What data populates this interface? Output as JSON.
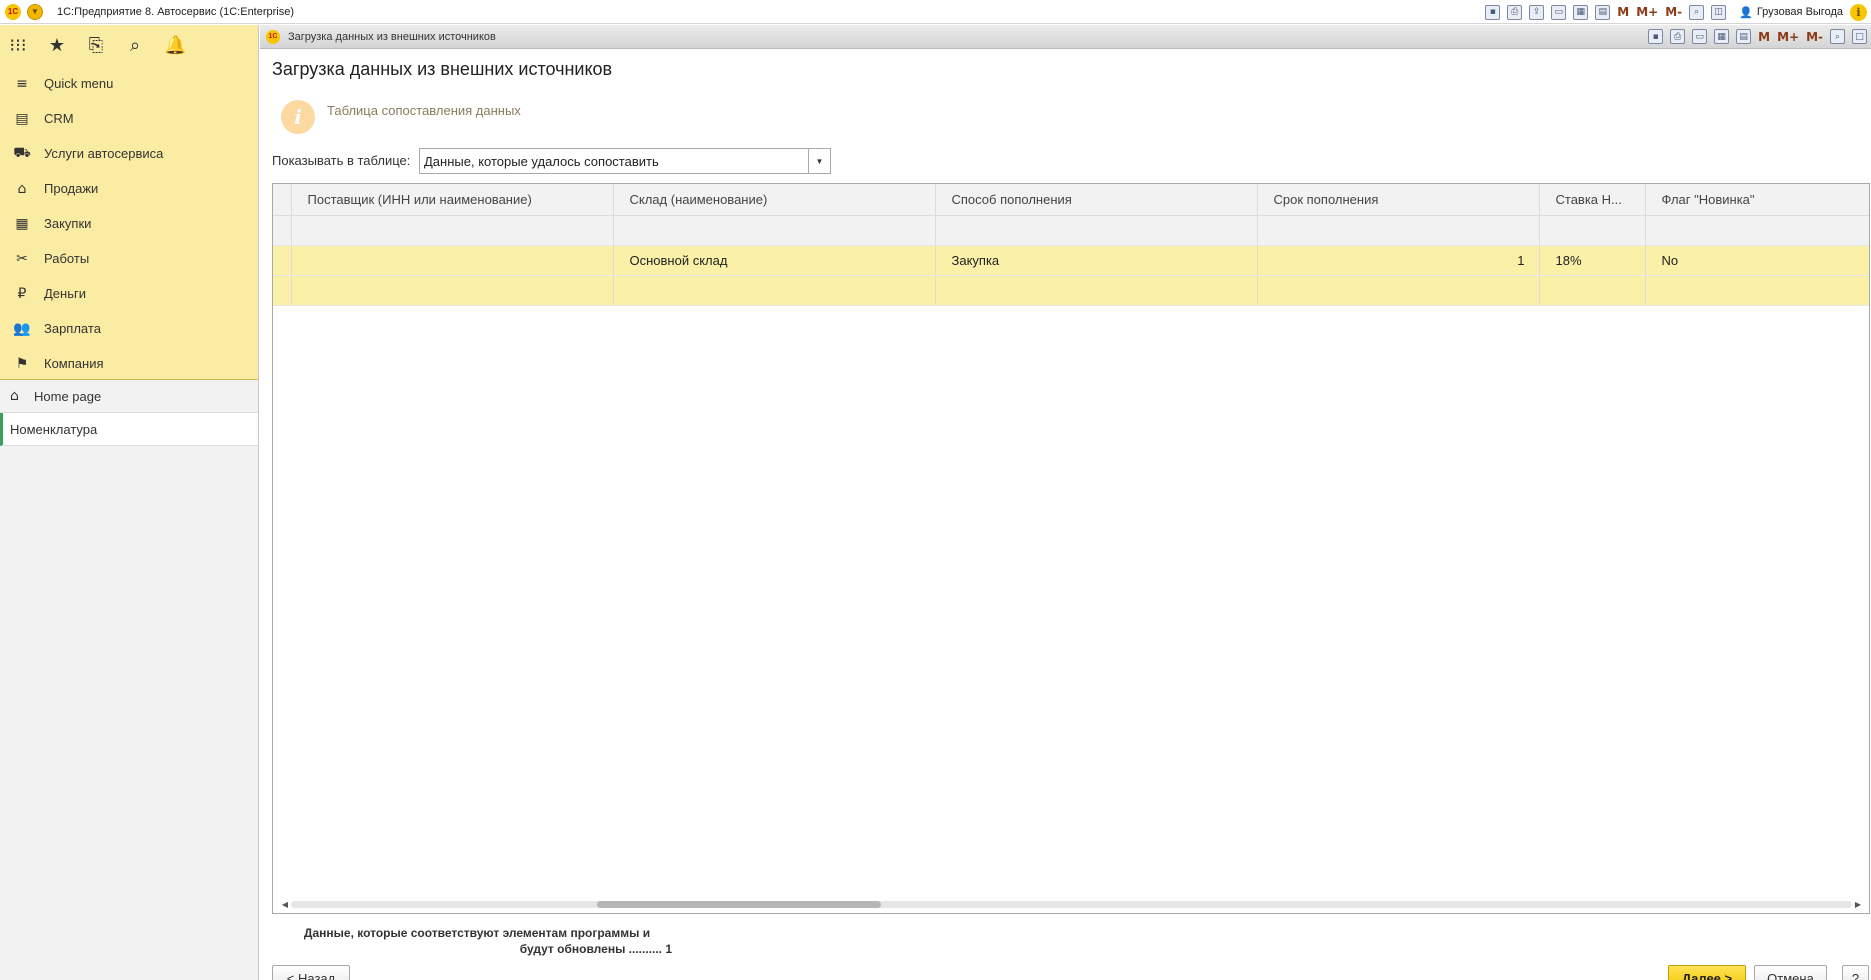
{
  "app": {
    "logo_text": "1C",
    "title": "1С:Предприятие 8. Автосервис  (1С:Enterprise)",
    "user": "Грузовая Выгода",
    "toolbar_m": [
      "M",
      "M+",
      "M-"
    ]
  },
  "sidebar": {
    "sections": [
      {
        "label": "Quick menu",
        "icon": "≡"
      },
      {
        "label": "CRM",
        "icon": "▤"
      },
      {
        "label": "Услуги автосервиса",
        "icon": "⛟"
      },
      {
        "label": "Продажи",
        "icon": "⌂"
      },
      {
        "label": "Закупки",
        "icon": "▦"
      },
      {
        "label": "Работы",
        "icon": "✂"
      },
      {
        "label": "Деньги",
        "icon": "₽"
      },
      {
        "label": "Зарплата",
        "icon": "👥"
      },
      {
        "label": "Компания",
        "icon": "⚑"
      }
    ],
    "home": "Home page",
    "open_windows": [
      "Номенклатура"
    ]
  },
  "window": {
    "tab_title": "Загрузка данных из внешних источников",
    "toolbar_m": [
      "M",
      "M+",
      "M-"
    ]
  },
  "form": {
    "title": "Загрузка данных из внешних источников",
    "hint": "Таблица сопоставления данных",
    "show_label": "Показывать в таблице:",
    "show_value": "Данные, которые удалось сопоставить"
  },
  "table": {
    "columns": [
      "Поставщик (ИНН или наименование)",
      "Склад (наименование)",
      "Способ пополнения",
      "Срок пополнения",
      "Ставка Н...",
      "Флаг \"Новинка\""
    ],
    "rows": [
      [
        "",
        "Основной склад",
        "Закупка",
        "1",
        "18%",
        "No"
      ]
    ]
  },
  "summary": {
    "line1": "Данные, которые соответствуют элементам программы и",
    "line2": "будут обновлены .......... 1"
  },
  "buttons": {
    "back": "< Назад",
    "next": "Далее >",
    "cancel": "Отмена",
    "help": "?"
  }
}
